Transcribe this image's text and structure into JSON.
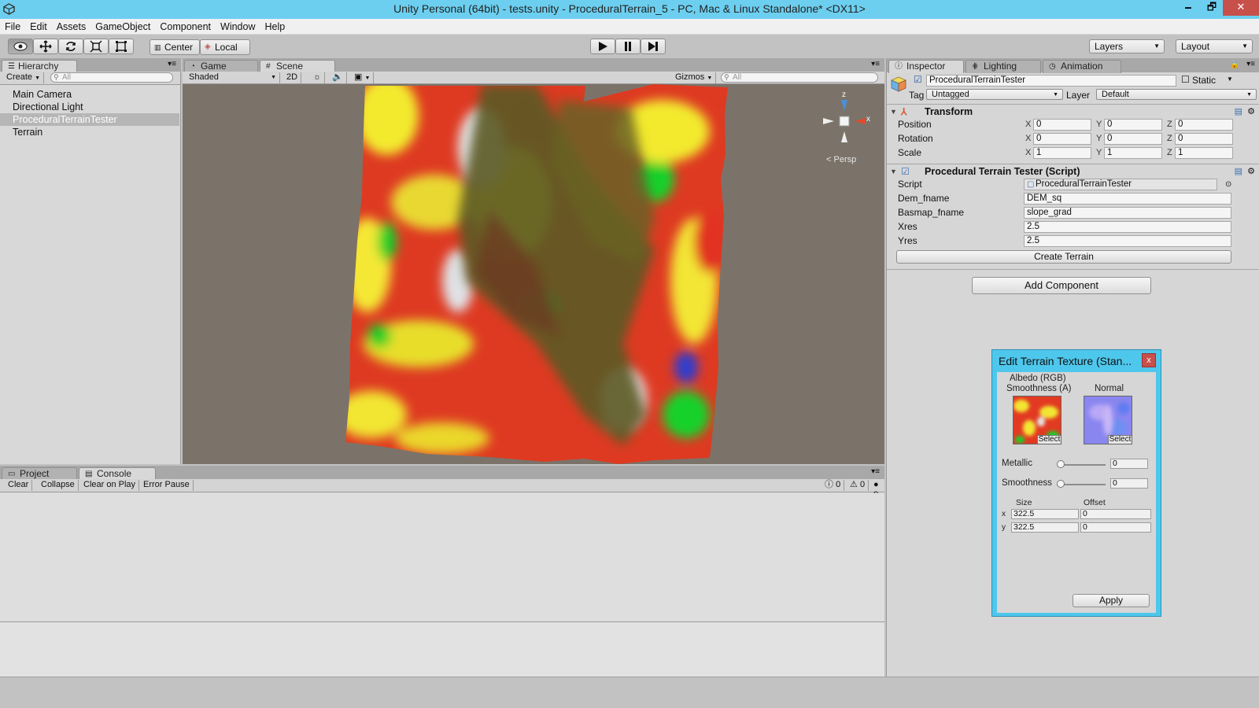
{
  "window": {
    "title": "Unity Personal (64bit) - tests.unity - ProceduralTerrain_5 - PC, Mac & Linux Standalone* <DX11>",
    "minimize": "🗕",
    "maximize": "🗗",
    "close": "✕"
  },
  "menu": [
    "File",
    "Edit",
    "Assets",
    "GameObject",
    "Component",
    "Window",
    "Help"
  ],
  "toolbar": {
    "pivot": "Center",
    "space": "Local",
    "layers": "Layers",
    "layout": "Layout"
  },
  "hierarchy": {
    "tab": "Hierarchy",
    "create": "Create",
    "search_placeholder": "All",
    "items": [
      "Main Camera",
      "Directional Light",
      "ProceduralTerrainTester",
      "Terrain"
    ],
    "selected_index": 2
  },
  "scene": {
    "tabs": [
      "Game",
      "Scene"
    ],
    "active_tab": "Scene",
    "shading": "Shaded",
    "mode_2d": "2D",
    "gizmos": "Gizmos",
    "search_placeholder": "All",
    "persp_label": "Persp",
    "gizmo_axes": {
      "z": "z",
      "x": "x"
    }
  },
  "bottom": {
    "tabs": [
      "Project",
      "Console"
    ],
    "active_tab": "Console",
    "console_buttons": [
      "Clear",
      "Collapse",
      "Clear on Play",
      "Error Pause"
    ],
    "counts": {
      "info": "0",
      "warning": "0",
      "error": "0"
    }
  },
  "inspector": {
    "tabs": [
      "Inspector",
      "Lighting",
      "Animation"
    ],
    "object_name": "ProceduralTerrainTester",
    "static_label": "Static",
    "tag_label": "Tag",
    "tag_value": "Untagged",
    "layer_label": "Layer",
    "layer_value": "Default",
    "transform": {
      "title": "Transform",
      "rows": [
        {
          "label": "Position",
          "x": "0",
          "y": "0",
          "z": "0"
        },
        {
          "label": "Rotation",
          "x": "0",
          "y": "0",
          "z": "0"
        },
        {
          "label": "Scale",
          "x": "1",
          "y": "1",
          "z": "1"
        }
      ]
    },
    "script_component": {
      "title": "Procedural Terrain Tester (Script)",
      "fields": [
        {
          "label": "Script",
          "value": "ProceduralTerrainTester"
        },
        {
          "label": "Dem_fname",
          "value": "DEM_sq"
        },
        {
          "label": "Basmap_fname",
          "value": "slope_grad"
        },
        {
          "label": "Xres",
          "value": "2.5"
        },
        {
          "label": "Yres",
          "value": "2.5"
        }
      ],
      "button": "Create Terrain"
    },
    "add_component": "Add Component"
  },
  "dialog": {
    "title": "Edit Terrain Texture (Stan...",
    "close": "x",
    "albedo_label_1": "Albedo (RGB)",
    "albedo_label_2": "Smoothness (A)",
    "normal_label": "Normal",
    "select": "Select",
    "metallic_label": "Metallic",
    "metallic_value": "0",
    "smoothness_label": "Smoothness",
    "smoothness_value": "0",
    "size_label": "Size",
    "offset_label": "Offset",
    "x_label": "x",
    "y_label": "y",
    "size_x": "322.5",
    "size_y": "322.5",
    "offset_x": "0",
    "offset_y": "0",
    "apply": "Apply"
  }
}
